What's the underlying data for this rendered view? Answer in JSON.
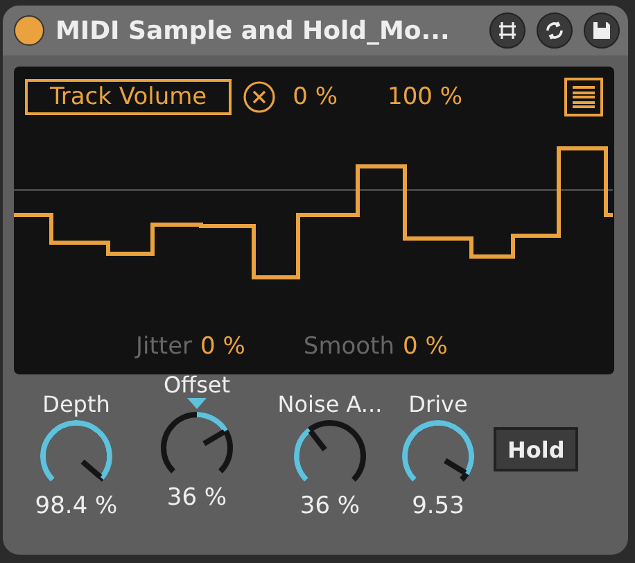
{
  "window": {
    "title": "MIDI Sample and Hold_Mo...",
    "active": true
  },
  "display": {
    "target": "Track Volume",
    "min": "0 %",
    "max": "100 %",
    "jitter_label": "Jitter",
    "jitter": "0 %",
    "smooth_label": "Smooth",
    "smooth": "0 %"
  },
  "knobs": [
    {
      "label": "Depth",
      "value": "98.4 %",
      "kind": "unipolar"
    },
    {
      "label": "Offset",
      "value": "36 %",
      "kind": "bipolar"
    },
    {
      "label": "Noise A...",
      "value": "36 %",
      "kind": "unipolar"
    },
    {
      "label": "Drive",
      "value": "9.53",
      "kind": "unipolar"
    }
  ],
  "hold": {
    "label": "Hold",
    "on": false
  }
}
